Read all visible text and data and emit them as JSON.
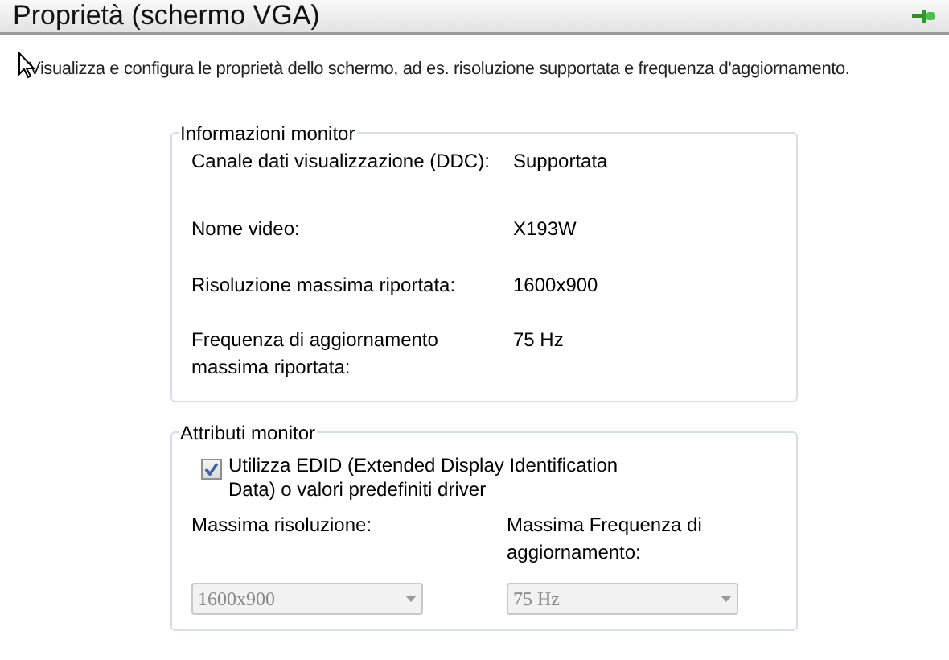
{
  "header": {
    "title": "Proprietà (schermo VGA)"
  },
  "description": "Visualizza e configura le proprietà dello schermo, ad es. risoluzione supportata e frequenza d'aggiornamento.",
  "monitor_info": {
    "title": "Informazioni monitor",
    "rows": [
      {
        "label": "Canale dati visualizzazione (DDC):",
        "value": "Supportata"
      },
      {
        "label": "Nome video:",
        "value": "X193W"
      },
      {
        "label": "Risoluzione massima riportata:",
        "value": "1600x900"
      },
      {
        "label": "Frequenza di aggiornamento massima riportata:",
        "value": "75 Hz"
      }
    ]
  },
  "monitor_attributes": {
    "title": "Attributi monitor",
    "checkbox": {
      "label": "Utilizza EDID (Extended Display Identification Data) o valori predefiniti driver",
      "checked": true
    },
    "dropdowns": [
      {
        "label": "Massima risoluzione:",
        "value": "1600x900",
        "disabled": true
      },
      {
        "label": "Massima Frequenza di aggiornamento:",
        "value": "75 Hz",
        "disabled": true
      }
    ]
  }
}
